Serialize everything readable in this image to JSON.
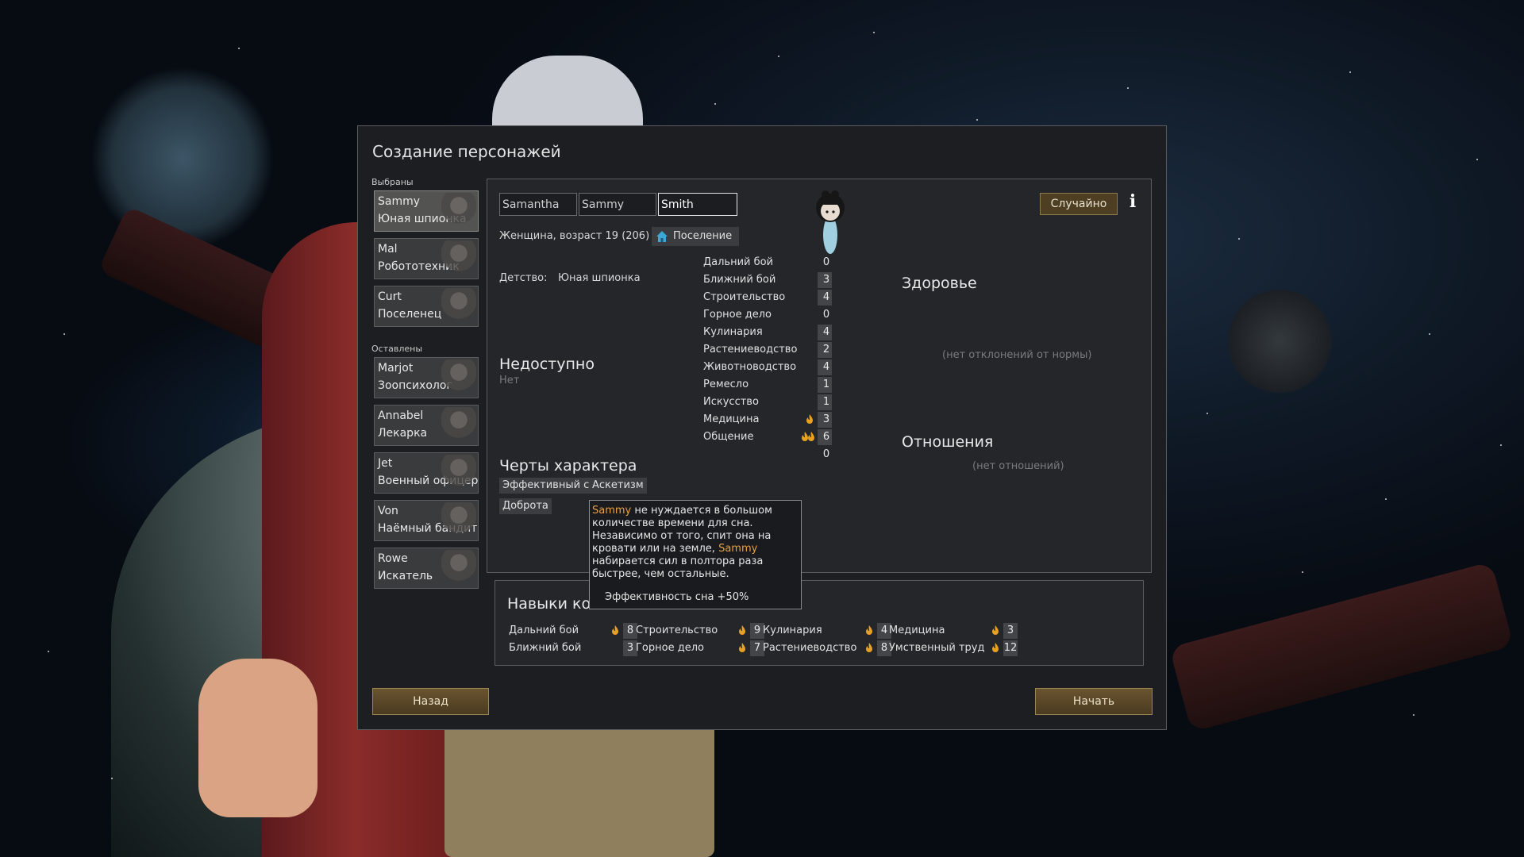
{
  "dialog": {
    "title": "Создание персонажей",
    "selected_label": "Выбраны",
    "left_label": "Оставлены"
  },
  "pawns_selected": [
    {
      "name": "Sammy",
      "role": "Юная шпионка"
    },
    {
      "name": "Mal",
      "role": "Робототехник"
    },
    {
      "name": "Curt",
      "role": "Поселенец"
    }
  ],
  "pawns_left": [
    {
      "name": "Marjot",
      "role": "Зоопсихолог"
    },
    {
      "name": "Annabel",
      "role": "Лекарка"
    },
    {
      "name": "Jet",
      "role": "Военный офицер"
    },
    {
      "name": "Von",
      "role": "Наёмный бандит"
    },
    {
      "name": "Rowe",
      "role": "Искатель"
    }
  ],
  "character": {
    "first_name": "Samantha",
    "nick_name": "Sammy",
    "last_name": "Smith",
    "random_button": "Случайно",
    "gender_age": "Женщина, возраст 19 (206)",
    "faction": "Поселение",
    "childhood_label": "Детство:",
    "childhood_value": "Юная шпионка",
    "incapable_heading": "Недоступно",
    "incapable_value": "Нет",
    "traits_heading": "Черты характера",
    "traits": [
      "Эффективный сон",
      "Аскетизм",
      "Доброта"
    ],
    "health_heading": "Здоровье",
    "health_value": "(нет отклонений от нормы)",
    "relations_heading": "Отношения",
    "relations_value": "(нет отношений)"
  },
  "skills": [
    {
      "name": "Дальний бой",
      "level": "0",
      "passion": 0
    },
    {
      "name": "Ближний бой",
      "level": "3",
      "passion": 0
    },
    {
      "name": "Строительство",
      "level": "4",
      "passion": 0
    },
    {
      "name": "Горное дело",
      "level": "0",
      "passion": 0
    },
    {
      "name": "Кулинария",
      "level": "4",
      "passion": 0
    },
    {
      "name": "Растениеводство",
      "level": "2",
      "passion": 0
    },
    {
      "name": "Животноводство",
      "level": "4",
      "passion": 0
    },
    {
      "name": "Ремесло",
      "level": "1",
      "passion": 0
    },
    {
      "name": "Искусство",
      "level": "1",
      "passion": 0
    },
    {
      "name": "Медицина",
      "level": "3",
      "passion": 1
    },
    {
      "name": "Общение",
      "level": "6",
      "passion": 2
    },
    {
      "name": "",
      "level": "0",
      "passion": 0
    }
  ],
  "tooltip": {
    "name1": "Sammy",
    "text1": " не нуждается в большом количестве времени для сна. Независимо от того, спит она на кровати или на земле, ",
    "name2": "Sammy",
    "text2": " набирается сил в полтора раза быстрее, чем остальные.",
    "effect": "Эффективность сна +50%"
  },
  "team": {
    "heading": "Навыки ко",
    "skills": [
      {
        "name": "Дальний бой",
        "level": "8",
        "passion": true
      },
      {
        "name": "Ближний бой",
        "level": "3",
        "passion": false
      },
      {
        "name": "Строительство",
        "level": "9",
        "passion": true
      },
      {
        "name": "Горное дело",
        "level": "7",
        "passion": true
      },
      {
        "name": "Кулинария",
        "level": "4",
        "passion": true
      },
      {
        "name": "Растениеводство",
        "level": "8",
        "passion": true
      },
      {
        "name": "Медицина",
        "level": "3",
        "passion": true
      },
      {
        "name": "Умственный труд",
        "level": "12",
        "passion": true
      }
    ]
  },
  "buttons": {
    "back": "Назад",
    "start": "Начать"
  },
  "colors": {
    "passion_flame": "#e8a020",
    "highlight_name": "#e8a040",
    "wood_button": "#5a4628"
  },
  "icons": {
    "random": "dice",
    "info": "info-icon",
    "faction": "house-icon",
    "passion": "flame-icon"
  }
}
